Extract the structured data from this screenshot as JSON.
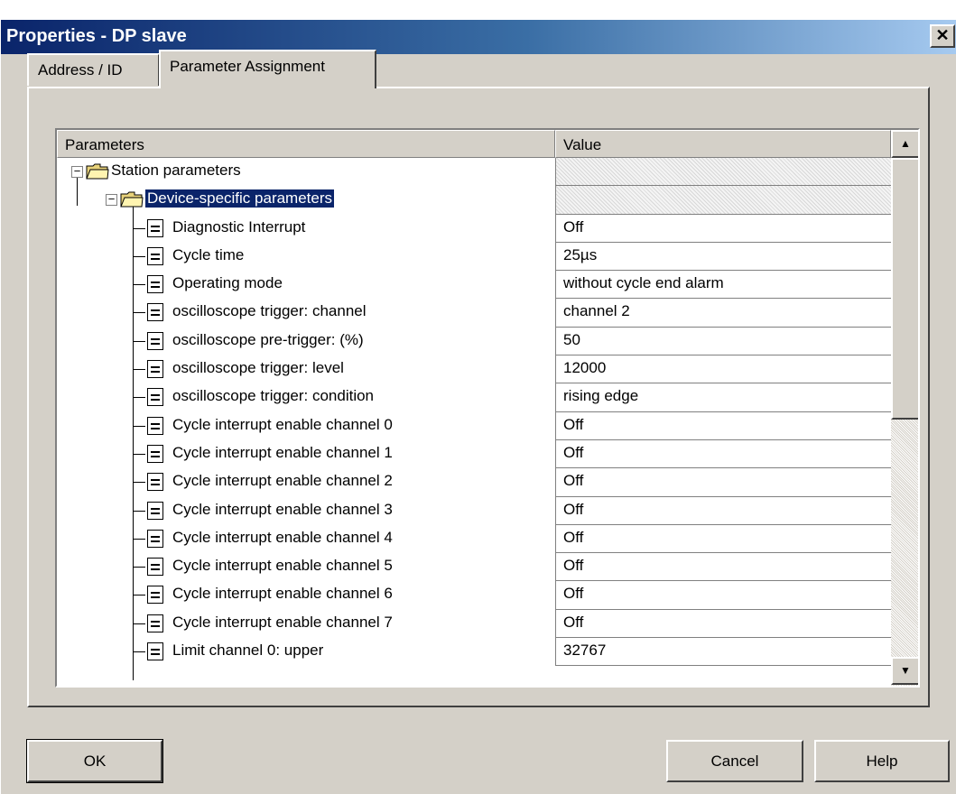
{
  "window": {
    "title": "Properties - DP slave",
    "close_label": "✕"
  },
  "tabs": [
    {
      "label": "Address / ID"
    },
    {
      "label": "Parameter Assignment"
    }
  ],
  "grid": {
    "columns": {
      "parameters": "Parameters",
      "value": "Value"
    },
    "tree": [
      {
        "label": "Station parameters",
        "value": ""
      },
      {
        "label": "Device-specific parameters",
        "value": ""
      }
    ],
    "rows": [
      {
        "label": "Diagnostic Interrupt",
        "value": "Off"
      },
      {
        "label": "Cycle time",
        "value": "25µs"
      },
      {
        "label": "Operating mode",
        "value": "without cycle end alarm"
      },
      {
        "label": "oscilloscope trigger: channel",
        "value": "channel 2"
      },
      {
        "label": "oscilloscope pre-trigger: (%)",
        "value": "50"
      },
      {
        "label": "oscilloscope trigger: level",
        "value": "12000"
      },
      {
        "label": "oscilloscope trigger: condition",
        "value": "rising edge"
      },
      {
        "label": "Cycle interrupt enable channel 0",
        "value": "Off"
      },
      {
        "label": "Cycle interrupt enable channel 1",
        "value": "Off"
      },
      {
        "label": "Cycle interrupt enable channel 2",
        "value": "Off"
      },
      {
        "label": "Cycle interrupt enable channel 3",
        "value": "Off"
      },
      {
        "label": "Cycle interrupt enable channel 4",
        "value": "Off"
      },
      {
        "label": "Cycle interrupt enable channel 5",
        "value": "Off"
      },
      {
        "label": "Cycle interrupt enable channel 6",
        "value": "Off"
      },
      {
        "label": "Cycle interrupt enable channel 7",
        "value": "Off"
      },
      {
        "label": "Limit channel 0: upper",
        "value": "32767"
      }
    ]
  },
  "scrollbar": {
    "up_arrow": "▲",
    "down_arrow": "▼"
  },
  "buttons": {
    "ok": "OK",
    "cancel": "Cancel",
    "help": "Help"
  },
  "icons": {
    "folder": "folder-icon",
    "parameter": "parameter-icon",
    "collapse": "collapse-icon"
  },
  "colors": {
    "title_start": "#0a246a",
    "title_end": "#a6caf0",
    "selection": "#0a246a",
    "face": "#d4d0c8"
  }
}
